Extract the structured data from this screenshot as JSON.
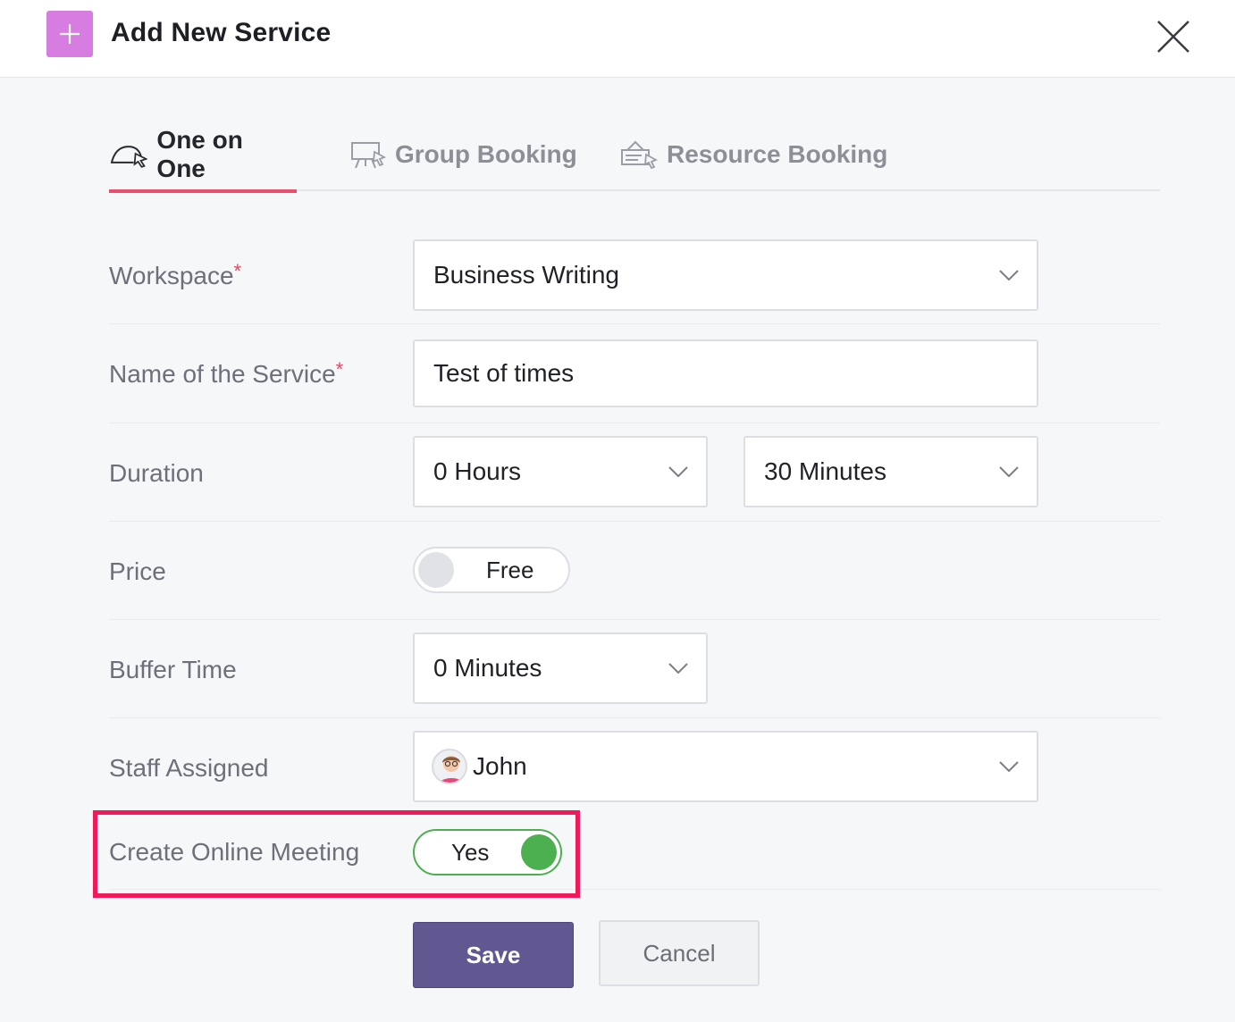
{
  "dialog": {
    "title": "Add New Service",
    "badge_color": "#d77de1"
  },
  "tabs": [
    {
      "label": "One on One",
      "icon": "one-on-one-icon",
      "active": true
    },
    {
      "label": "Group Booking",
      "icon": "group-booking-icon",
      "active": false
    },
    {
      "label": "Resource Booking",
      "icon": "resource-booking-icon",
      "active": false
    }
  ],
  "form": {
    "workspace": {
      "label": "Workspace",
      "required_mark": "*",
      "value": "Business Writing"
    },
    "service_name": {
      "label": "Name of the Service",
      "required_mark": "*",
      "value": "Test of times"
    },
    "duration": {
      "label": "Duration",
      "hours": "0 Hours",
      "minutes": "30 Minutes"
    },
    "price": {
      "label": "Price",
      "toggle_text": "Free",
      "enabled": false
    },
    "buffer_time": {
      "label": "Buffer Time",
      "value": "0 Minutes"
    },
    "staff": {
      "label": "Staff Assigned",
      "value": "John",
      "avatar_icon": "avatar-icon"
    },
    "online_meeting": {
      "label": "Create Online Meeting",
      "toggle_text": "Yes",
      "enabled": true
    }
  },
  "actions": {
    "save_label": "Save",
    "cancel_label": "Cancel"
  },
  "colors": {
    "accent_tab": "#ea4d6e",
    "save_button": "#615892",
    "toggle_on": "#4caf50",
    "highlight_box": "#f0195c"
  }
}
